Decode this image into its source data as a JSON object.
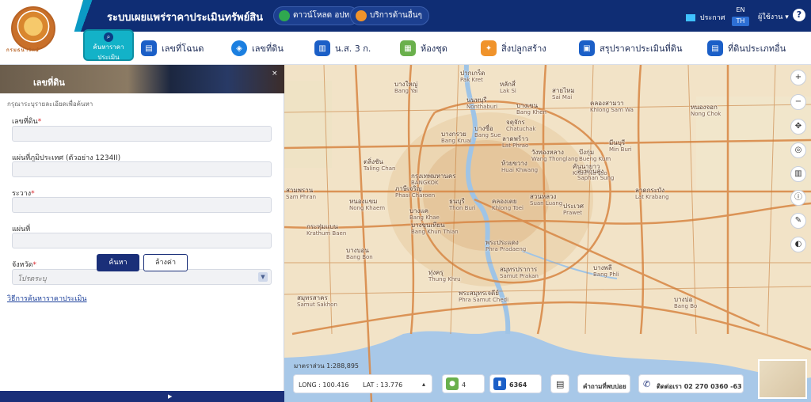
{
  "header": {
    "logo_text": "กรมธนารักษ์",
    "title": "ระบบเผยแพร่ราคาประเมินทรัพย์สิน",
    "download_btn": "ดาวน์โหลด อปท.",
    "services_btn": "บริการด้านอื่นๆ",
    "announce": "ประกาศ",
    "lang_en": "EN",
    "lang_th": "TH",
    "user": "ผู้ใช้งาน",
    "help": "?"
  },
  "nav": {
    "search_tab": "ค้นหาราคาประเมิน",
    "items": [
      {
        "label": "เลขที่โฉนด",
        "color": "#1b5fc7",
        "icon": "deed-icon"
      },
      {
        "label": "เลขที่ดิน",
        "color": "#1b7fe0",
        "icon": "layers-icon"
      },
      {
        "label": "น.ส. 3 ก.",
        "color": "#1b5fc7",
        "icon": "map-icon"
      },
      {
        "label": "ห้องชุด",
        "color": "#6ab04c",
        "icon": "building-icon"
      },
      {
        "label": "สิ่งปลูกสร้าง",
        "color": "#f0932b",
        "icon": "handshake-icon"
      },
      {
        "label": "สรุปราคาประเมินที่ดิน",
        "color": "#1b5fc7",
        "icon": "summary-icon"
      },
      {
        "label": "ที่ดินประเภทอื่น",
        "color": "#1b5fc7",
        "icon": "document-icon"
      }
    ]
  },
  "panel": {
    "title": "เลขที่ดิน",
    "close": "×",
    "hint": "กรุณาระบุรายละเอียดเพื่อค้นหา",
    "fields": [
      {
        "label": "เลขที่ดิน",
        "required": "*",
        "value": ""
      },
      {
        "label": "แผ่นที่ภูมิประเทศ (ตัวอย่าง 1234II)",
        "required": "",
        "value": ""
      },
      {
        "label": "ระวาง",
        "required": "*",
        "value": ""
      },
      {
        "label": "แผ่นที่",
        "required": "",
        "value": ""
      }
    ],
    "province_label": "จังหวัด",
    "province_req": "*",
    "province_placeholder": "โปรดระบุ",
    "method_link": "วิธีการค้นหาราคาประเมิน",
    "search_btn": "ค้นหา",
    "clear_btn": "ล้างค่า"
  },
  "map": {
    "scale": "มาตราส่วน 1:288,895",
    "long_label": "LONG : 100.416",
    "lat_label": "LAT : 13.776",
    "count_users": "4",
    "count_visits": "6364",
    "faq": "คำถามที่พบบ่อย",
    "contact": "ติดต่อเรา 02 270 0360 -63",
    "labels": [
      {
        "th": "ปากเกร็ด",
        "en": "Pak Kret"
      },
      {
        "th": "บางใหญ่",
        "en": "Bang Yai"
      },
      {
        "th": "หลักสี่",
        "en": "Lak Si"
      },
      {
        "th": "นนทบุรี",
        "en": "Nonthaburi"
      },
      {
        "th": "สายไหม",
        "en": "Sai Mai"
      },
      {
        "th": "คลองสามวา",
        "en": "Khlong Sam Wa"
      },
      {
        "th": "หนองจอก",
        "en": "Nong Chok"
      },
      {
        "th": "บางเขน",
        "en": "Bang Khen"
      },
      {
        "th": "บางกรวย",
        "en": "Bang Kruai"
      },
      {
        "th": "บางซื่อ",
        "en": "Bang Sue"
      },
      {
        "th": "จตุจักร",
        "en": "Chatuchak"
      },
      {
        "th": "ลาดพร้าว",
        "en": "Lat Phrao"
      },
      {
        "th": "มีนบุรี",
        "en": "Min Buri"
      },
      {
        "th": "บึงกุ่ม",
        "en": "Bueng Kum"
      },
      {
        "th": "คันนายาว",
        "en": "Khan Na Yao"
      },
      {
        "th": "สะพานสูง",
        "en": "Saphan Sung"
      },
      {
        "th": "ตลิ่งชัน",
        "en": "Taling Chan"
      },
      {
        "th": "กรุงเทพมหานคร",
        "en": "BANGKOK"
      },
      {
        "th": "ห้วยขวาง",
        "en": "Huai Khwang"
      },
      {
        "th": "วังทองหลาง",
        "en": "Wang Thonglang"
      },
      {
        "th": "ลาดกระบัง",
        "en": "Lat Krabang"
      },
      {
        "th": "สามพราน",
        "en": "Sam Phran"
      },
      {
        "th": "หนองแขม",
        "en": "Nong Khaem"
      },
      {
        "th": "ภาษีเจริญ",
        "en": "Phasi Charoen"
      },
      {
        "th": "ธนบุรี",
        "en": "Thon Buri"
      },
      {
        "th": "คลองเตย",
        "en": "Khlong Toei"
      },
      {
        "th": "สวนหลวง",
        "en": "Suan Luang"
      },
      {
        "th": "ประเวศ",
        "en": "Prawet"
      },
      {
        "th": "กระทุ่มแบน",
        "en": "Krathum Baen"
      },
      {
        "th": "บางแค",
        "en": "Bang Khae"
      },
      {
        "th": "บางขุนเทียน",
        "en": "Bang Khun Thian"
      },
      {
        "th": "พระประแดง",
        "en": "Phra Pradaeng"
      },
      {
        "th": "บางบอน",
        "en": "Bang Bon"
      },
      {
        "th": "ทุ่งครุ",
        "en": "Thung Khru"
      },
      {
        "th": "สมุทรปราการ",
        "en": "Samut Prakan"
      },
      {
        "th": "บางพลี",
        "en": "Bang Phli"
      },
      {
        "th": "พระสมุทรเจดีย์",
        "en": "Phra Samut Chedi"
      },
      {
        "th": "สมุทรสาคร",
        "en": "Samut Sakhon"
      },
      {
        "th": "บางบ่อ",
        "en": "Bang Bo"
      }
    ]
  }
}
